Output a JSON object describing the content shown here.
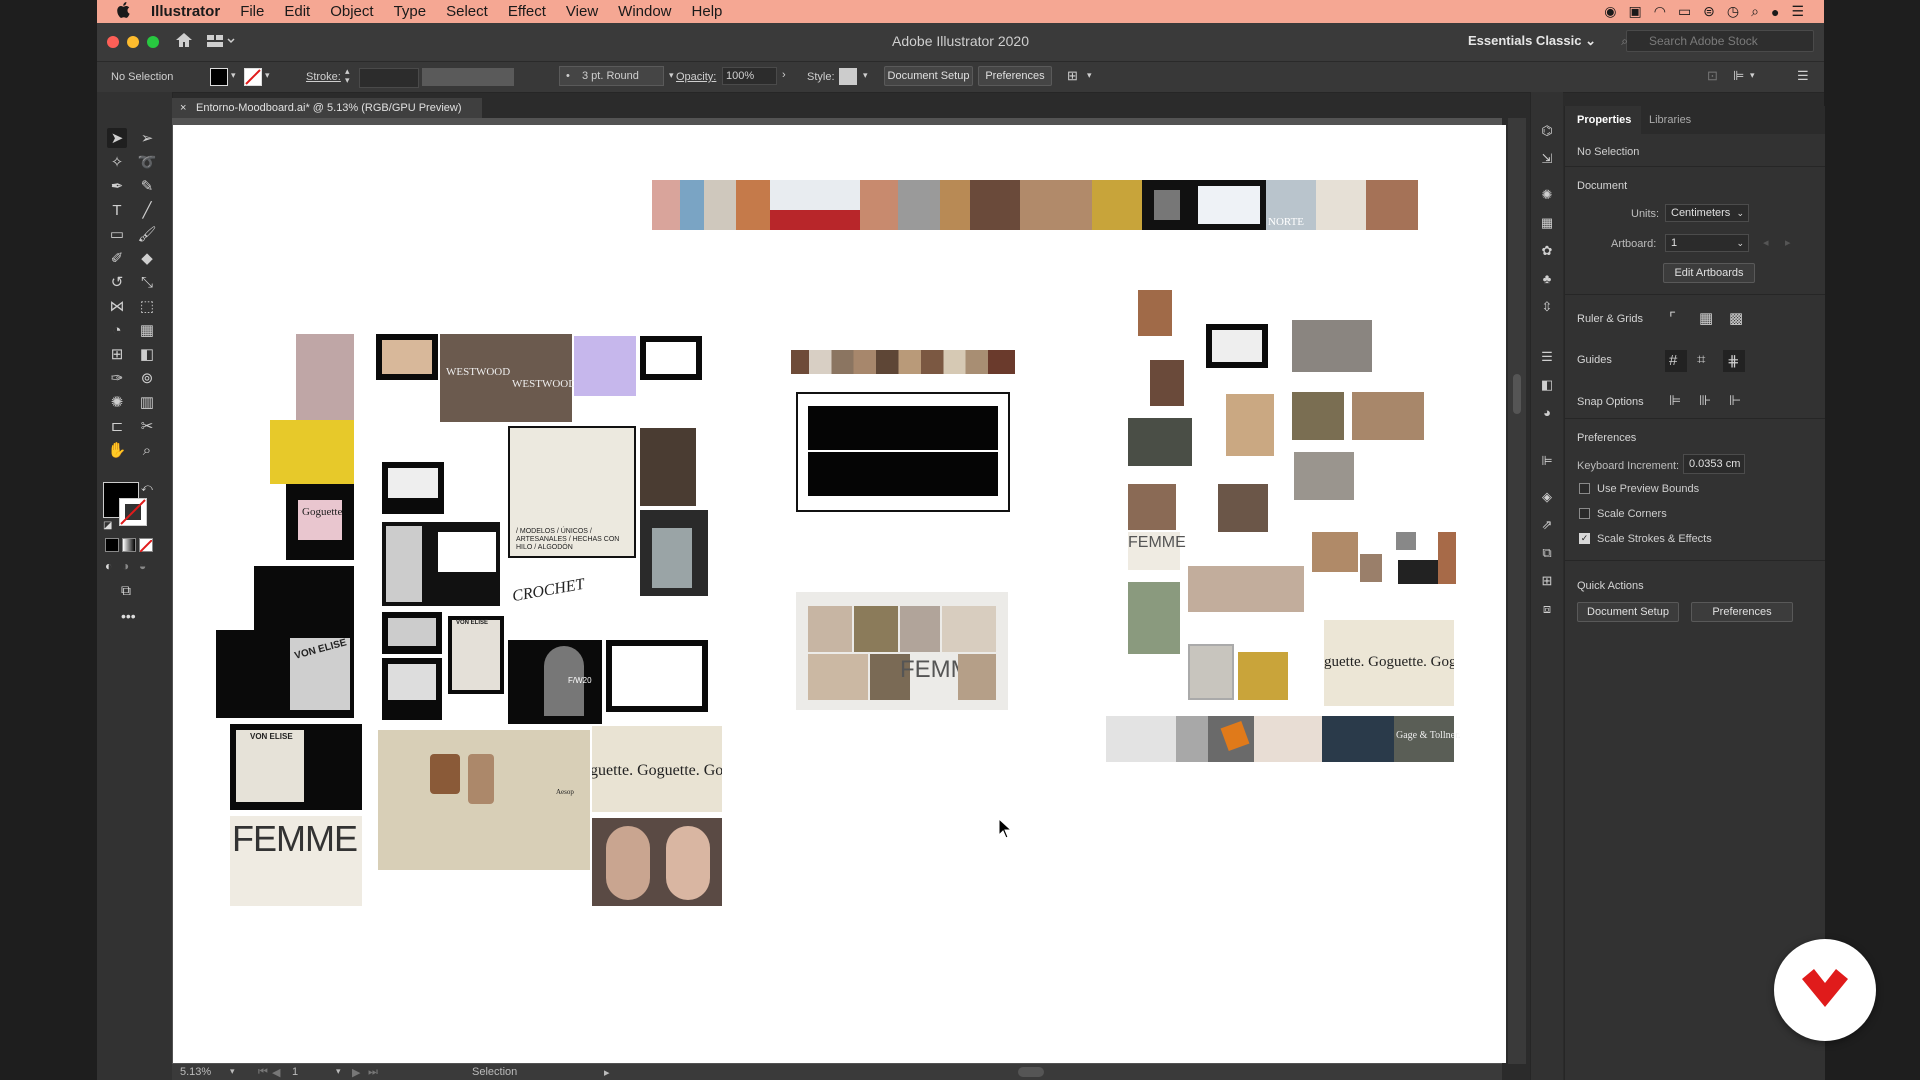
{
  "menubar": {
    "apple": "",
    "app": "Illustrator",
    "items": [
      "File",
      "Edit",
      "Object",
      "Type",
      "Select",
      "Effect",
      "View",
      "Window",
      "Help"
    ]
  },
  "appbar": {
    "title": "Adobe Illustrator 2020",
    "workspace": "Essentials Classic",
    "stock_placeholder": "Search Adobe Stock"
  },
  "controlbar": {
    "selection": "No Selection",
    "stroke_label": "Stroke:",
    "brush": "3 pt. Round",
    "opacity_label": "Opacity:",
    "opacity": "100%",
    "style_label": "Style:",
    "doc_setup": "Document Setup",
    "preferences": "Preferences"
  },
  "doc_tab": {
    "close": "×",
    "title": "Entorno-Moodboard.ai* @ 5.13% (RGB/GPU Preview)"
  },
  "status": {
    "zoom": "5.13%",
    "artboard": "1",
    "tool": "Selection"
  },
  "properties": {
    "tab_properties": "Properties",
    "tab_libraries": "Libraries",
    "selection": "No Selection",
    "document": "Document",
    "units_label": "Units:",
    "units": "Centimeters",
    "artboard_label": "Artboard:",
    "artboard": "1",
    "edit_artboards": "Edit Artboards",
    "ruler_grids": "Ruler & Grids",
    "guides": "Guides",
    "snap_options": "Snap Options",
    "preferences": "Preferences",
    "keyboard_increment_label": "Keyboard Increment:",
    "keyboard_increment": "0.0353 cm",
    "use_preview_bounds": "Use Preview Bounds",
    "scale_corners": "Scale Corners",
    "scale_strokes": "Scale Strokes & Effects",
    "quick_actions": "Quick Actions",
    "qa_doc_setup": "Document Setup",
    "qa_preferences": "Preferences"
  },
  "artwork": {
    "westwood": "WESTWOOD",
    "goguette": "Goguette",
    "von_elise": "VON ELISE",
    "femme": "FEMME",
    "crochet": "CROCHET",
    "norte": "NORTE",
    "goguette_banner": "guette. Goguette. Gogue",
    "aesop": "Aesop",
    "gage": "Gage & Tollner.",
    "fw": "F/W20",
    "modelos": "/ MODELOS / ÚNICOS / ARTESANALES / HECHAS CON HILO / ALGODÓN"
  },
  "colors": {
    "menubar": "#f5a793",
    "brand_red": "#e01b1b"
  }
}
